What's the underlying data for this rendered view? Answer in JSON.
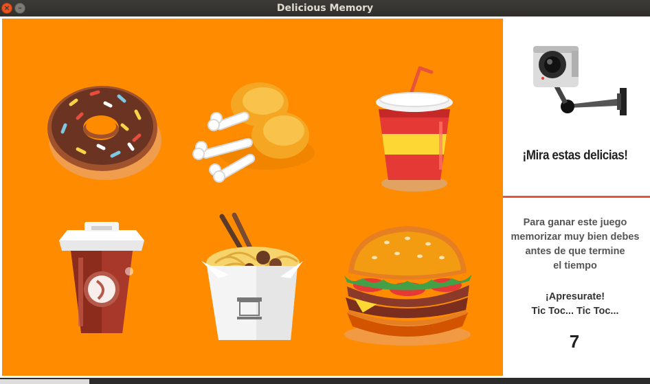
{
  "window": {
    "title": "Delicious Memory"
  },
  "controls": {
    "close_glyph": "×",
    "minimize_glyph": "–"
  },
  "board": {
    "background": "#ff8c00",
    "cards": [
      {
        "id": "donut",
        "icon": "donut-icon"
      },
      {
        "id": "chicken",
        "icon": "chicken-drumsticks-icon"
      },
      {
        "id": "soda",
        "icon": "soda-cup-icon"
      },
      {
        "id": "coffee",
        "icon": "coffee-cup-icon"
      },
      {
        "id": "noodles",
        "icon": "noodle-box-icon"
      },
      {
        "id": "burger",
        "icon": "burger-icon"
      }
    ]
  },
  "side": {
    "camera_icon": "security-camera-icon",
    "headline": "¡Mira estas delicias!",
    "instructions": [
      "Para ganar este juego",
      "memorizar muy bien debes",
      "antes de que termine",
      "el tiempo"
    ],
    "hurry": [
      "¡Apresurate!",
      "Tic Toc... Tic Toc..."
    ],
    "countdown": "7",
    "divider_color": "#e8543a"
  }
}
